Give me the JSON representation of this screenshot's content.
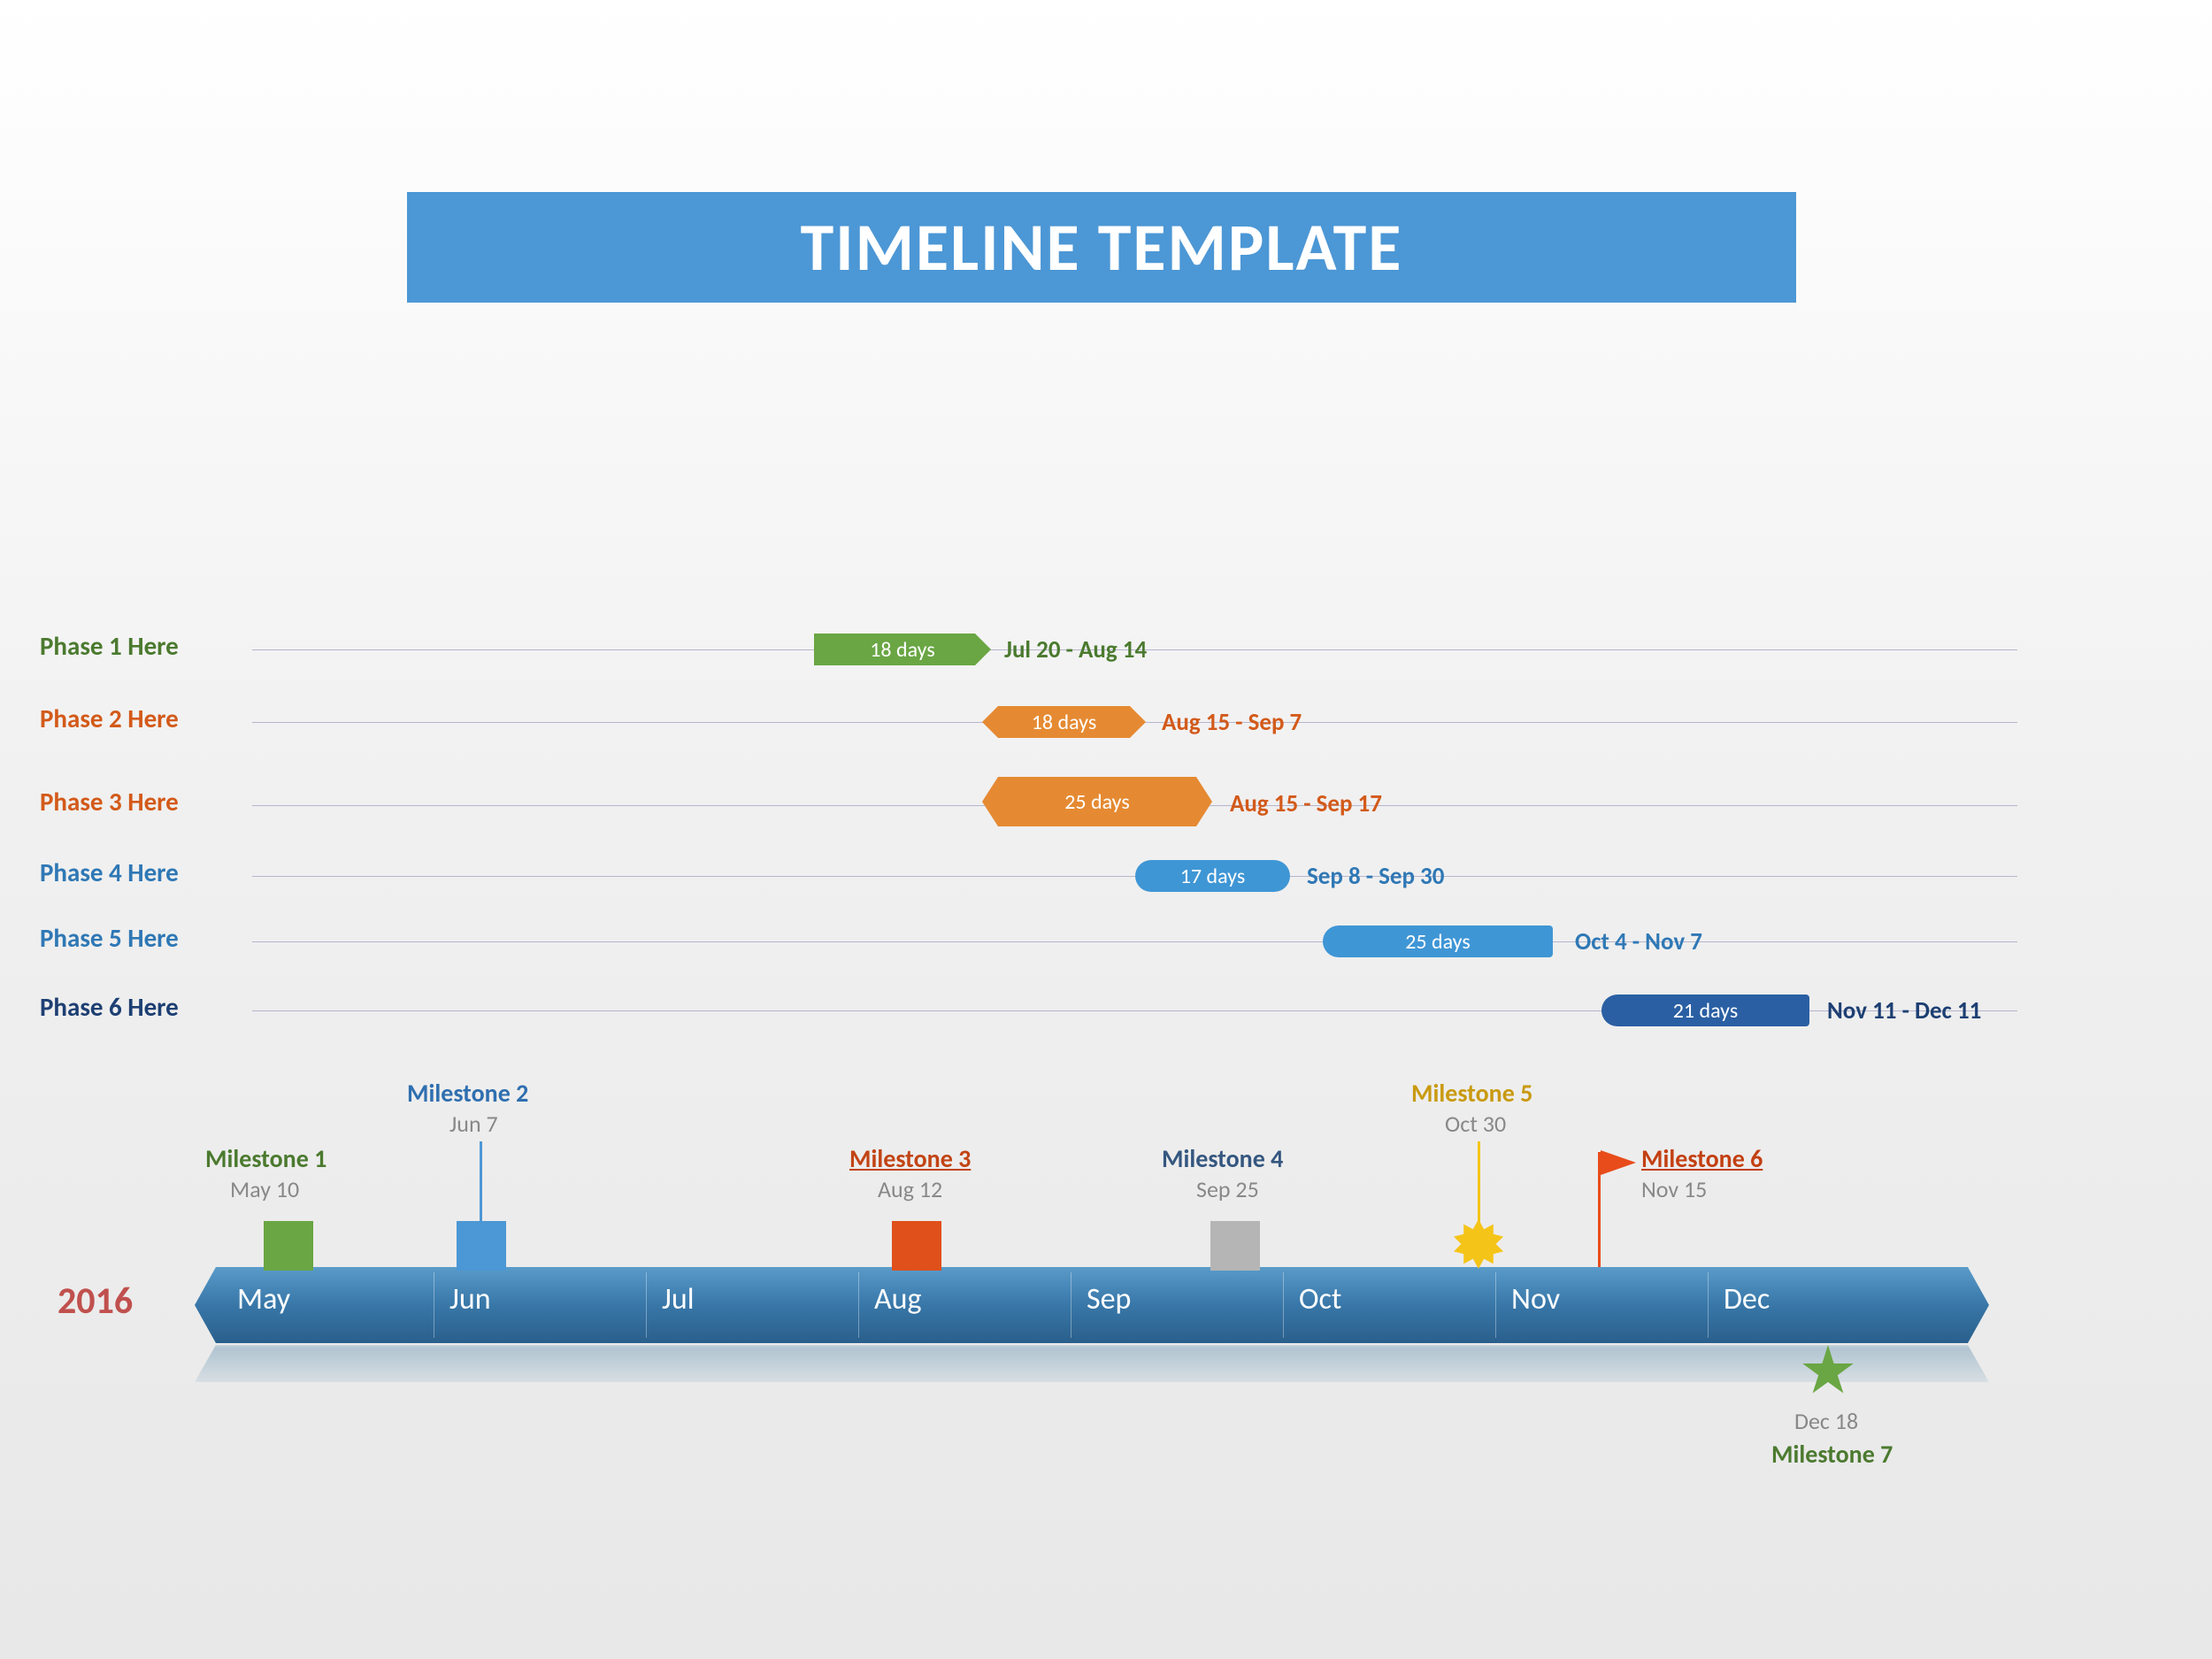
{
  "title": "TIMELINE TEMPLATE",
  "year": "2016",
  "months": [
    "May",
    "Jun",
    "Jul",
    "Aug",
    "Sep",
    "Oct",
    "Nov",
    "Dec"
  ],
  "phases": [
    {
      "name": "Phase 1 Here",
      "duration": "18 days",
      "range": "Jul 20 - Aug 14",
      "color": "#6aa644",
      "label_color": "#4b7a2f"
    },
    {
      "name": "Phase 2 Here",
      "duration": "18 days",
      "range": "Aug 15 - Sep 7",
      "color": "#e58a32",
      "label_color": "#d35a1a"
    },
    {
      "name": "Phase 3 Here",
      "duration": "25 days",
      "range": "Aug 15 - Sep 17",
      "color": "#e58a32",
      "label_color": "#d35a1a"
    },
    {
      "name": "Phase 4 Here",
      "duration": "17 days",
      "range": "Sep 8 - Sep 30",
      "color": "#3f96d5",
      "label_color": "#2f78b5"
    },
    {
      "name": "Phase 5 Here",
      "duration": "25 days",
      "range": "Oct 4 - Nov 7",
      "color": "#3f96d5",
      "label_color": "#2f78b5"
    },
    {
      "name": "Phase 6 Here",
      "duration": "21 days",
      "range": "Nov 11 - Dec 11",
      "color": "#2a5fa3",
      "label_color": "#1d3f73"
    }
  ],
  "milestones": [
    {
      "name": "Milestone 1",
      "date": "May 10",
      "marker": "square",
      "color": "#6aa644",
      "label_color": "#4b7a2f",
      "pos": "above"
    },
    {
      "name": "Milestone 2",
      "date": "Jun 7",
      "marker": "square",
      "color": "#4c97d5",
      "label_color": "#2f6fb0",
      "pos": "above"
    },
    {
      "name": "Milestone 3",
      "date": "Aug 12",
      "marker": "square",
      "color": "#e0501a",
      "label_color": "#c24414",
      "pos": "above",
      "underline": true
    },
    {
      "name": "Milestone 4",
      "date": "Sep 25",
      "marker": "square",
      "color": "#b5b5b5",
      "label_color": "#355780",
      "pos": "above"
    },
    {
      "name": "Milestone 5",
      "date": "Oct 30",
      "marker": "starburst",
      "color": "#f5c418",
      "label_color": "#c99a10",
      "pos": "above"
    },
    {
      "name": "Milestone 6",
      "date": "Nov 15",
      "marker": "flag",
      "color": "#e84c1a",
      "label_color": "#c34012",
      "pos": "above",
      "underline": true
    },
    {
      "name": "Milestone 7",
      "date": "Dec 18",
      "marker": "star",
      "color": "#6aa644",
      "label_color": "#4b7a2f",
      "pos": "below"
    }
  ],
  "chart_data": {
    "type": "timeline",
    "year": 2016,
    "axis_start": "2016-05-01",
    "axis_end": "2016-12-31",
    "phases": [
      {
        "name": "Phase 1 Here",
        "start": "2016-07-20",
        "end": "2016-08-14",
        "duration_days": 18
      },
      {
        "name": "Phase 2 Here",
        "start": "2016-08-15",
        "end": "2016-09-07",
        "duration_days": 18
      },
      {
        "name": "Phase 3 Here",
        "start": "2016-08-15",
        "end": "2016-09-17",
        "duration_days": 25
      },
      {
        "name": "Phase 4 Here",
        "start": "2016-09-08",
        "end": "2016-09-30",
        "duration_days": 17
      },
      {
        "name": "Phase 5 Here",
        "start": "2016-10-04",
        "end": "2016-11-07",
        "duration_days": 25
      },
      {
        "name": "Phase 6 Here",
        "start": "2016-11-11",
        "end": "2016-12-11",
        "duration_days": 21
      }
    ],
    "milestones": [
      {
        "name": "Milestone 1",
        "date": "2016-05-10"
      },
      {
        "name": "Milestone 2",
        "date": "2016-06-07"
      },
      {
        "name": "Milestone 3",
        "date": "2016-08-12"
      },
      {
        "name": "Milestone 4",
        "date": "2016-09-25"
      },
      {
        "name": "Milestone 5",
        "date": "2016-10-30"
      },
      {
        "name": "Milestone 6",
        "date": "2016-11-15"
      },
      {
        "name": "Milestone 7",
        "date": "2016-12-18"
      }
    ]
  }
}
